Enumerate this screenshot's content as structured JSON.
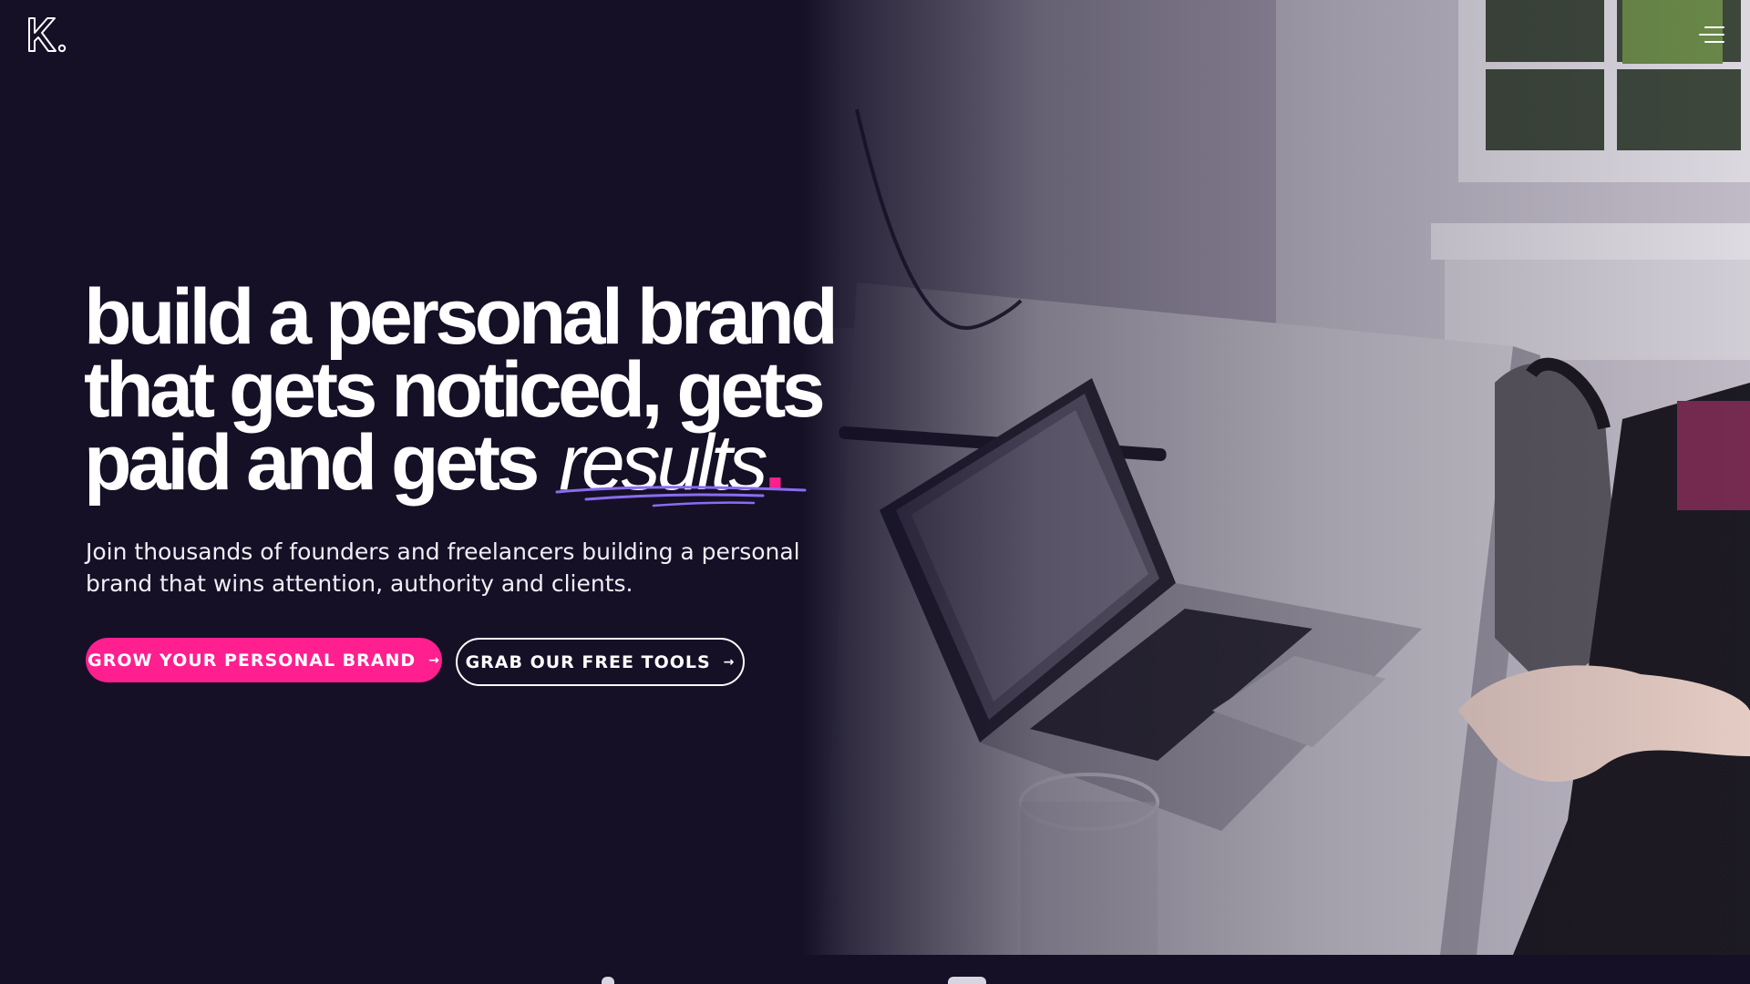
{
  "brand": {
    "logo_letter": "K.",
    "accent_color": "#ff1f8f",
    "underline_color": "#8a6cf0",
    "background_color": "#151026"
  },
  "header": {
    "menu_icon": "hamburger-menu-icon"
  },
  "hero": {
    "title_line_1": "build a personal brand",
    "title_line_2": "that gets noticed, gets",
    "title_line_3_prefix": "paid and gets",
    "title_accent_word": "results",
    "title_accent_dot": ".",
    "subtitle": "Join thousands of founders and freelancers building a personal brand that wins attention, authority and clients.",
    "primary_cta": {
      "label": "GROW YOUR PERSONAL BRAND",
      "arrow": "→"
    },
    "secondary_cta": {
      "label": "GRAB OUR FREE TOOLS",
      "arrow": "→"
    }
  }
}
